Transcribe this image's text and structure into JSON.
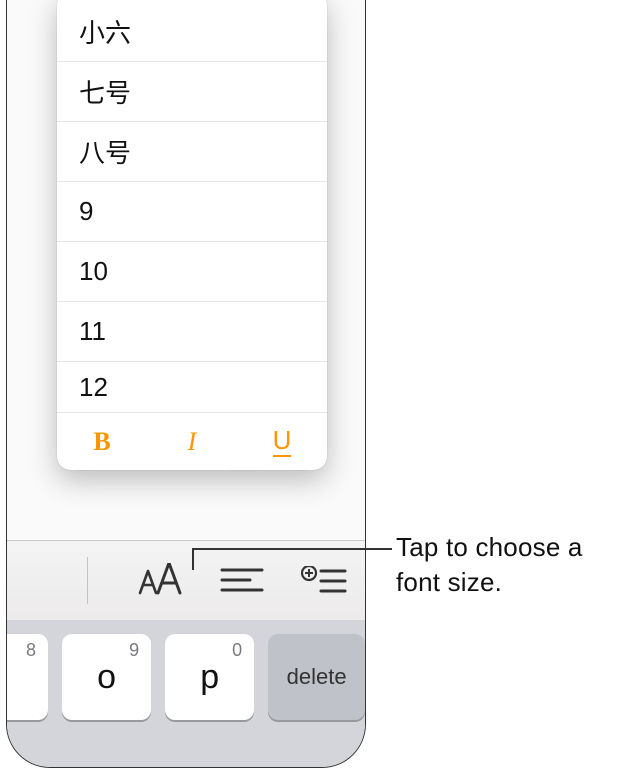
{
  "popover": {
    "sizes": [
      "小六",
      "七号",
      "八号",
      "9",
      "10",
      "11",
      "12"
    ],
    "bold_label": "B",
    "italic_label": "I",
    "underline_label": "U"
  },
  "toolbar": {
    "font_size_button": "font-size-icon",
    "align_button": "align-icon",
    "list_button": "list-plus-icon"
  },
  "keyboard": {
    "keys": [
      {
        "hint": "8",
        "main": ""
      },
      {
        "hint": "9",
        "main": "o"
      },
      {
        "hint": "0",
        "main": "p"
      }
    ],
    "delete_label": "delete"
  },
  "callout": {
    "text": "Tap to choose a font size."
  }
}
